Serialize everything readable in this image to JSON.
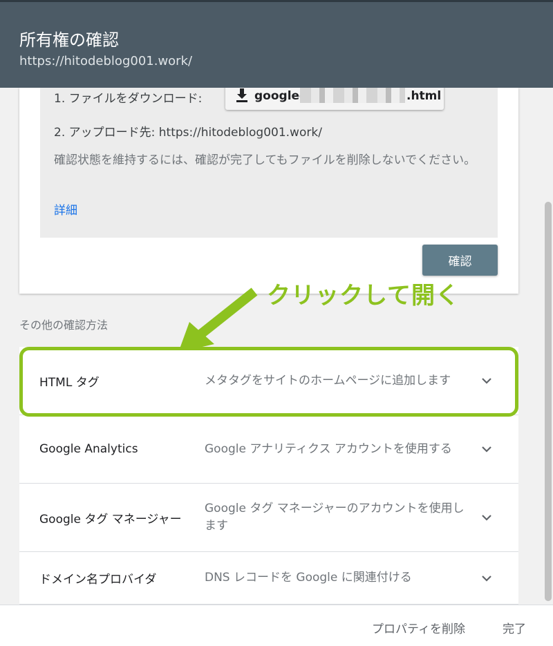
{
  "header": {
    "title": "所有権の確認",
    "site_url": "https://hitodeblog001.work/"
  },
  "verification_card": {
    "step1_label": "1. ファイルをダウンロード:",
    "download_file_prefix": "googlee",
    "download_file_suffix": ".html",
    "step2_label": "2. アップロード先: https://hitodeblog001.work/",
    "note": "確認状態を維持するには、確認が完了してもファイルを削除しないでください。",
    "detail_link": "詳細",
    "verify_button": "確認"
  },
  "other_methods": {
    "section_label": "その他の確認方法",
    "items": [
      {
        "name": "HTML タグ",
        "description": "メタタグをサイトのホームページに追加します"
      },
      {
        "name": "Google Analytics",
        "description": "Google アナリティクス アカウントを使用する"
      },
      {
        "name": "Google タグ マネージャー",
        "description": "Google タグ マネージャーのアカウントを使用します"
      },
      {
        "name": "ドメイン名プロバイダ",
        "description": "DNS レコードを Google に関連付ける"
      }
    ]
  },
  "annotation": {
    "text": "クリックして開く",
    "color": "#8dc21f"
  },
  "footer": {
    "delete_property": "プロパティを削除",
    "done": "完了"
  },
  "colors": {
    "header_bg": "#4c5b66",
    "verify_button_bg": "#607d8b",
    "link": "#1a73e8",
    "highlight": "#8dc21f"
  }
}
